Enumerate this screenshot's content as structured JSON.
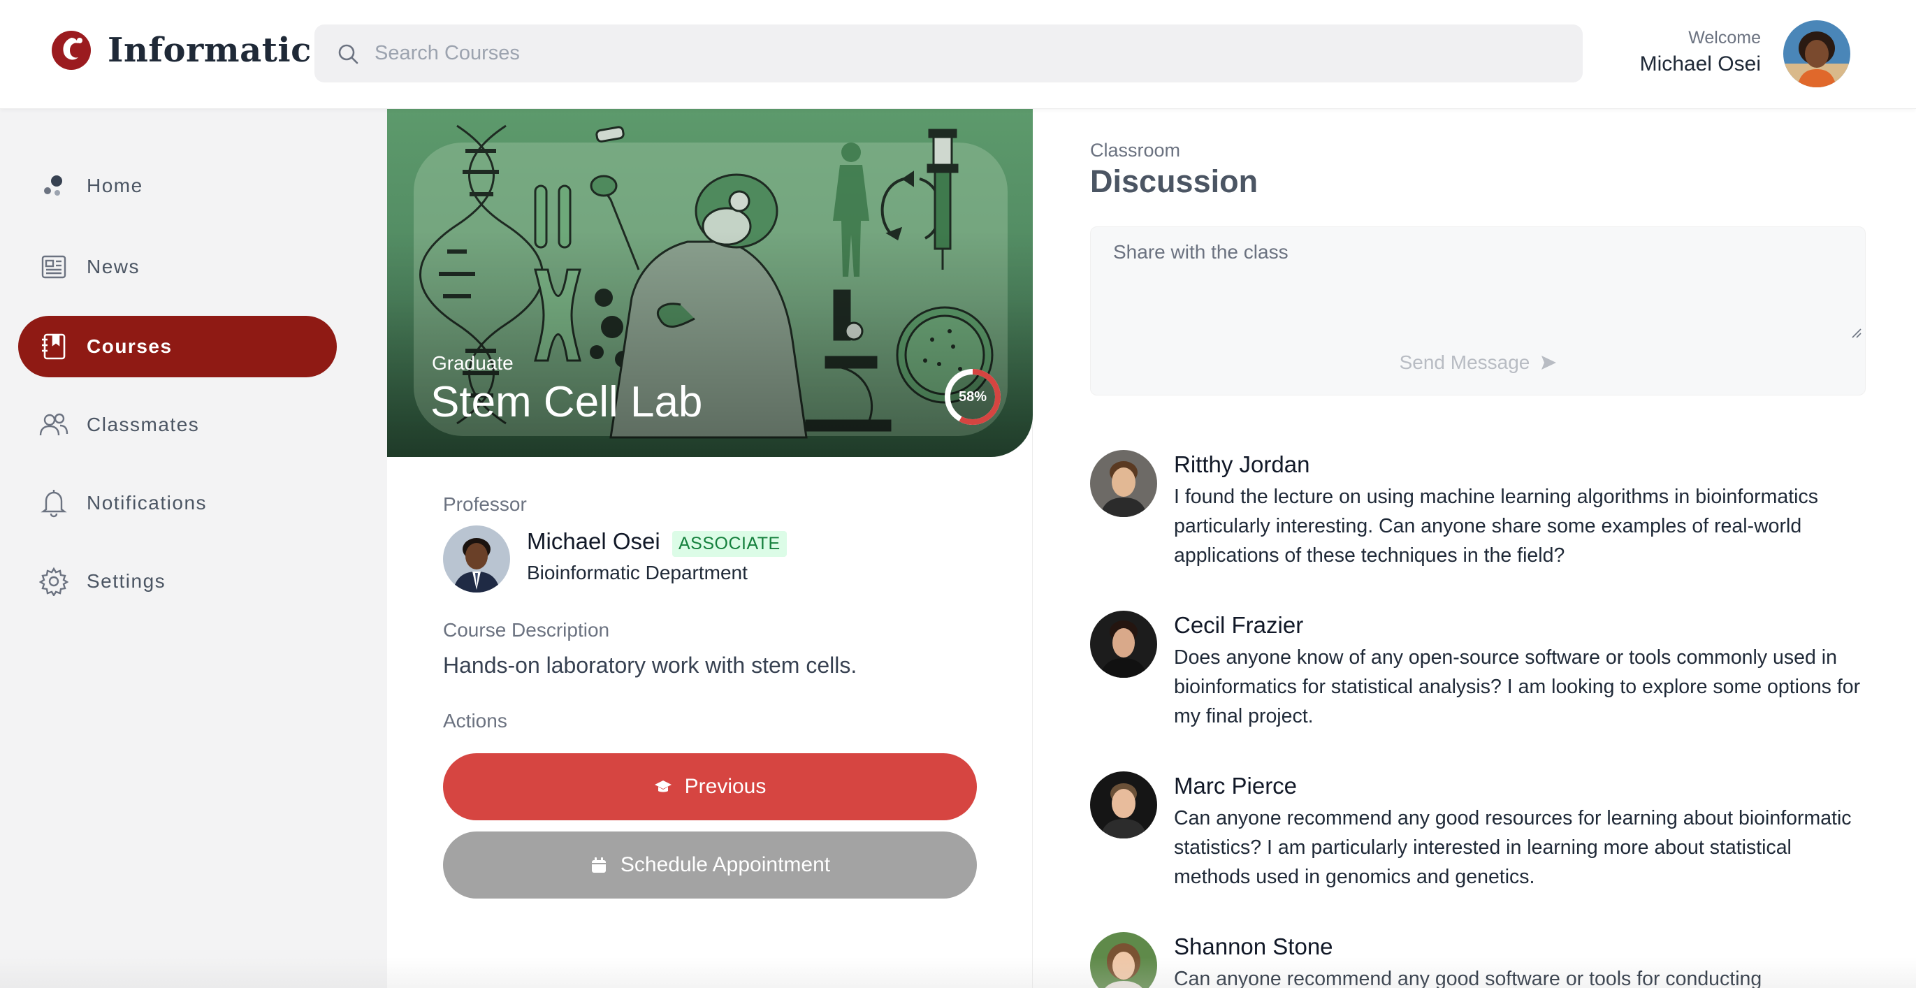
{
  "brand": {
    "name": "Informatic",
    "accent": "#8f1a14"
  },
  "search": {
    "placeholder": "Search Courses"
  },
  "user": {
    "welcome_label": "Welcome",
    "name": "Michael Osei"
  },
  "sidebar": {
    "items": [
      {
        "label": "Home",
        "icon": "home-icon"
      },
      {
        "label": "News",
        "icon": "newspaper-icon"
      },
      {
        "label": "Courses",
        "icon": "book-icon",
        "active": true
      },
      {
        "label": "Classmates",
        "icon": "people-icon"
      },
      {
        "label": "Notifications",
        "icon": "bell-icon"
      },
      {
        "label": "Settings",
        "icon": "gear-icon"
      }
    ]
  },
  "course": {
    "level": "Graduate",
    "title": "Stem Cell Lab",
    "progress_label": "58%",
    "progress_value": 0.58,
    "professor_label": "Professor",
    "professor": {
      "name": "Michael Osei",
      "badge": "ASSOCIATE",
      "department": "Bioinformatic Department"
    },
    "description_label": "Course Description",
    "description": "Hands-on laboratory work with stem cells.",
    "actions_label": "Actions",
    "actions": {
      "previous": "Previous",
      "schedule": "Schedule Appointment"
    }
  },
  "discussion": {
    "subtitle": "Classroom",
    "title": "Discussion",
    "placeholder": "Share with the class",
    "send_label": "Send Message",
    "posts": [
      {
        "name": "Ritthy Jordan",
        "text": "I found the lecture on using machine learning algorithms in bioinformatics particularly interesting. Can anyone share some examples of real-world applications of these techniques in the field?"
      },
      {
        "name": "Cecil Frazier",
        "text": "Does anyone know of any open-source software or tools commonly used in bioinformatics for statistical analysis? I am looking to explore some options for my final project."
      },
      {
        "name": "Marc Pierce",
        "text": "Can anyone recommend any good resources for learning about bioinformatic statistics? I am particularly interested in learning more about statistical methods used in genomics and genetics."
      },
      {
        "name": "Shannon Stone",
        "text": "Can anyone recommend any good software or tools for conducting"
      }
    ]
  }
}
